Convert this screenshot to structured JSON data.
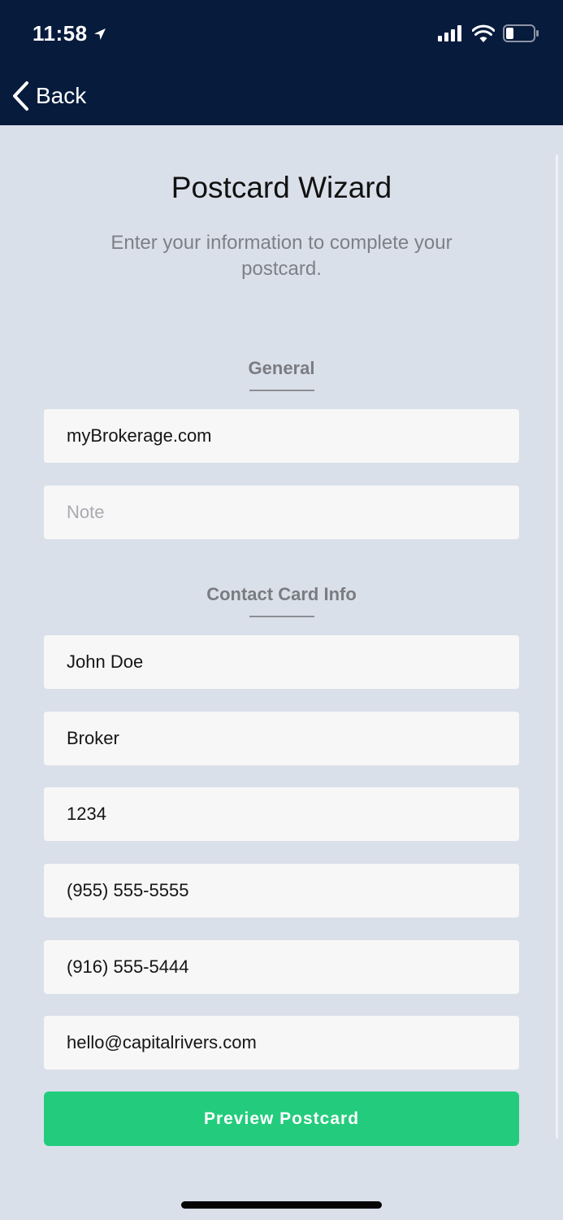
{
  "status_bar": {
    "time": "11:58",
    "icons": [
      "location-arrow-icon",
      "signal-icon",
      "wifi-icon",
      "battery-icon"
    ]
  },
  "nav": {
    "back_label": "Back"
  },
  "page": {
    "title": "Postcard Wizard",
    "subtitle": "Enter your information to complete your postcard."
  },
  "general": {
    "label": "General",
    "website_value": "myBrokerage.com",
    "note_placeholder": "Note"
  },
  "contact": {
    "label": "Contact Card Info",
    "name_value": "John Doe",
    "title_value": "Broker",
    "license_value": "1234",
    "phone_value": "(955) 555-5555",
    "phone2_value": "(916) 555-5444",
    "email_value": "hello@capitalrivers.com"
  },
  "actions": {
    "preview_label": "Preview Postcard"
  },
  "colors": {
    "header_bg": "#071b3c",
    "page_bg": "#dae0ea",
    "field_bg": "#f7f7f7",
    "accent_green": "#22cc7c"
  }
}
